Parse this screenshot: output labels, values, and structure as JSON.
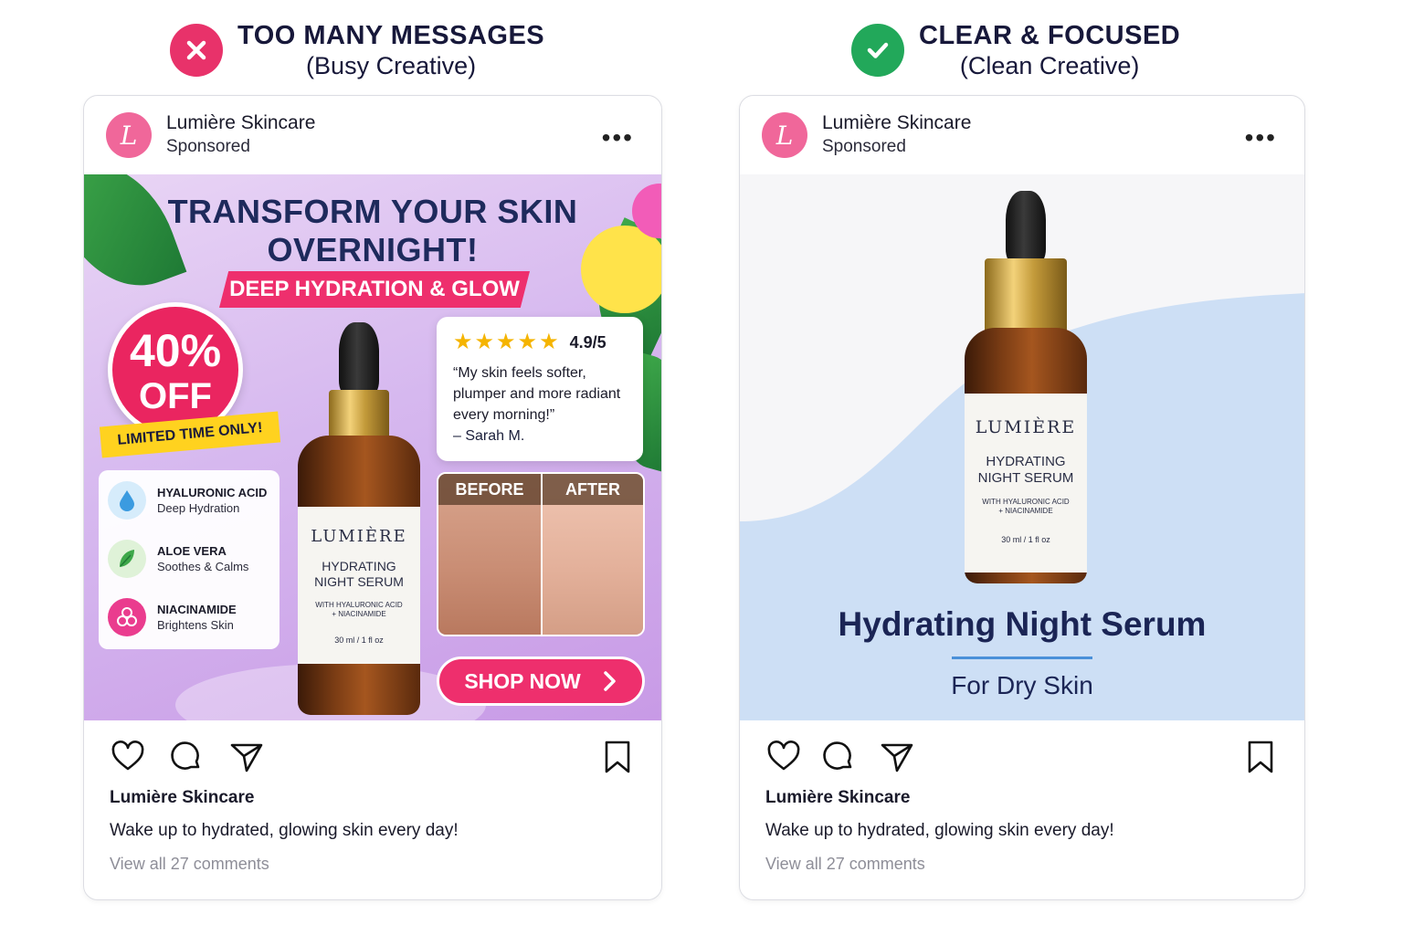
{
  "left_column": {
    "title": "TOO MANY MESSAGES",
    "subtitle": "(Busy Creative)",
    "mark_icon": "x-icon",
    "mark_color": "#e8326a",
    "post": {
      "account_name": "Lumière Skincare",
      "account_sub": "Sponsored",
      "avatar_letter": "L",
      "more_label": "•••",
      "creative": {
        "headline_line1": "TRANSFORM YOUR SKIN",
        "headline_line2": "OVERNIGHT!",
        "ribbon": "DEEP HYDRATION & GLOW",
        "discount_pct": "40%",
        "discount_off": "OFF",
        "limited": "LIMITED TIME ONLY!",
        "ingredients": [
          {
            "name": "HYALURONIC ACID",
            "benefit": "Deep Hydration",
            "icon": "droplet-icon"
          },
          {
            "name": "ALOE VERA",
            "benefit": "Soothes & Calms",
            "icon": "leaf-icon"
          },
          {
            "name": "NIACINAMIDE",
            "benefit": "Brightens Skin",
            "icon": "molecule-icon"
          }
        ],
        "rating": "4.9/5",
        "stars": 5,
        "quote": "“My skin feels softer, plumper and more radiant every morning!”",
        "quote_author": "– Sarah M.",
        "before_label": "BEFORE",
        "after_label": "AFTER",
        "cta": "SHOP NOW",
        "bottle": {
          "brand": "LUMIÈRE",
          "name_line1": "HYDRATING",
          "name_line2": "NIGHT SERUM",
          "with_line1": "WITH HYALURONIC ACID",
          "with_line2": "+ NIACINAMIDE",
          "volume": "30 ml / 1 fl oz"
        }
      },
      "caption_name": "Lumière Skincare",
      "caption_text": "Wake up to hydrated, glowing skin every day!",
      "comments": "View all 27 comments"
    }
  },
  "right_column": {
    "title": "CLEAR & FOCUSED",
    "subtitle": "(Clean Creative)",
    "mark_icon": "check-icon",
    "mark_color": "#22a85a",
    "post": {
      "account_name": "Lumière Skincare",
      "account_sub": "Sponsored",
      "avatar_letter": "L",
      "more_label": "•••",
      "creative": {
        "title": "Hydrating Night Serum",
        "subtitle": "For Dry Skin",
        "bottle": {
          "brand": "LUMIÈRE",
          "name_line1": "HYDRATING",
          "name_line2": "NIGHT SERUM",
          "with_line1": "WITH HYALURONIC ACID",
          "with_line2": "+ NIACINAMIDE",
          "volume": "30 ml / 1 fl oz"
        }
      },
      "caption_name": "Lumière Skincare",
      "caption_text": "Wake up to hydrated, glowing skin every day!",
      "comments": "View all 27 comments"
    }
  },
  "colors": {
    "brand_pink": "#ee2f6d",
    "navy": "#1b2555",
    "clean_wave": "#cddff5"
  }
}
